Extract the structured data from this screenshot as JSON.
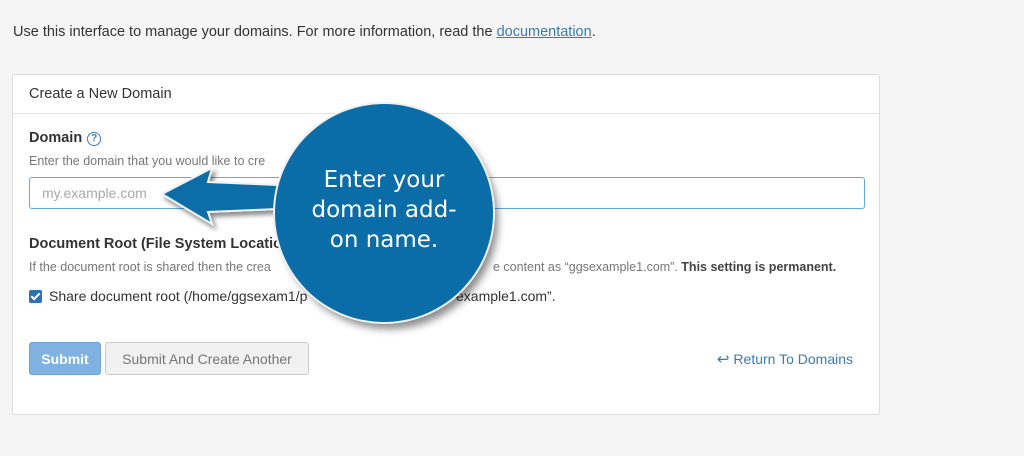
{
  "intro": {
    "text": "Use this interface to manage your domains. For more information, read the ",
    "link": "documentation",
    "suffix": "."
  },
  "panel": {
    "title": "Create a New Domain",
    "domain": {
      "label": "Domain",
      "help_icon": "question-circle-icon",
      "hint": "Enter the domain that you would like to cre",
      "placeholder": "my.example.com",
      "value": ""
    },
    "doc_root": {
      "label": "Document Root (File System Location)",
      "hint_start": "If the document root is shared then the crea",
      "hint_end": "e content as “ggsexample1.com”. ",
      "hint_strong": "This setting is permanent.",
      "checkbox_checked": true,
      "checkbox_label_start": "Share document root (/home/ggsexam1/p",
      "checkbox_label_end": "example1.com”."
    },
    "buttons": {
      "submit": "Submit",
      "submit_another": "Submit And Create Another",
      "return_icon": "return-arrow-icon",
      "return": "Return To Domains"
    }
  },
  "callout": {
    "text": "Enter your domain add-on name.",
    "circle_color": "#0b6da7",
    "arrow_icon": "left-arrow-icon"
  }
}
